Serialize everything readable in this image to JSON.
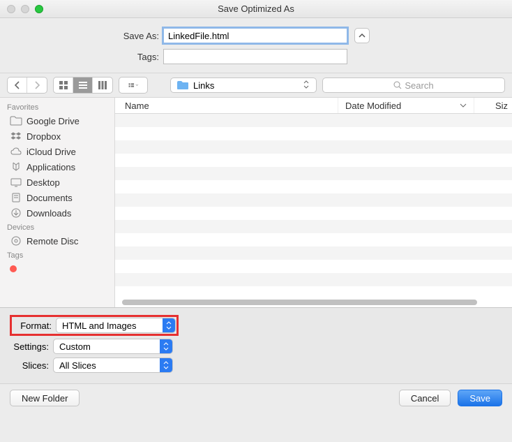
{
  "window": {
    "title": "Save Optimized As"
  },
  "form": {
    "saveas_label": "Save As:",
    "saveas_value": "LinkedFile.html",
    "tags_label": "Tags:",
    "tags_value": ""
  },
  "toolbar": {
    "location": "Links",
    "search_placeholder": "Search"
  },
  "columns": {
    "name": "Name",
    "dateModified": "Date Modified",
    "size": "Siz"
  },
  "sidebar": {
    "favorites_header": "Favorites",
    "items": [
      {
        "label": "Google Drive",
        "icon": "folder"
      },
      {
        "label": "Dropbox",
        "icon": "dropbox"
      },
      {
        "label": "iCloud Drive",
        "icon": "cloud"
      },
      {
        "label": "Applications",
        "icon": "apps"
      },
      {
        "label": "Desktop",
        "icon": "desktop"
      },
      {
        "label": "Documents",
        "icon": "documents"
      },
      {
        "label": "Downloads",
        "icon": "downloads"
      }
    ],
    "devices_header": "Devices",
    "devices": [
      {
        "label": "Remote Disc",
        "icon": "disc"
      }
    ],
    "tags_header": "Tags"
  },
  "options": {
    "format_label": "Format:",
    "format_value": "HTML and Images",
    "settings_label": "Settings:",
    "settings_value": "Custom",
    "slices_label": "Slices:",
    "slices_value": "All Slices"
  },
  "footer": {
    "new_folder": "New Folder",
    "cancel": "Cancel",
    "save": "Save"
  }
}
